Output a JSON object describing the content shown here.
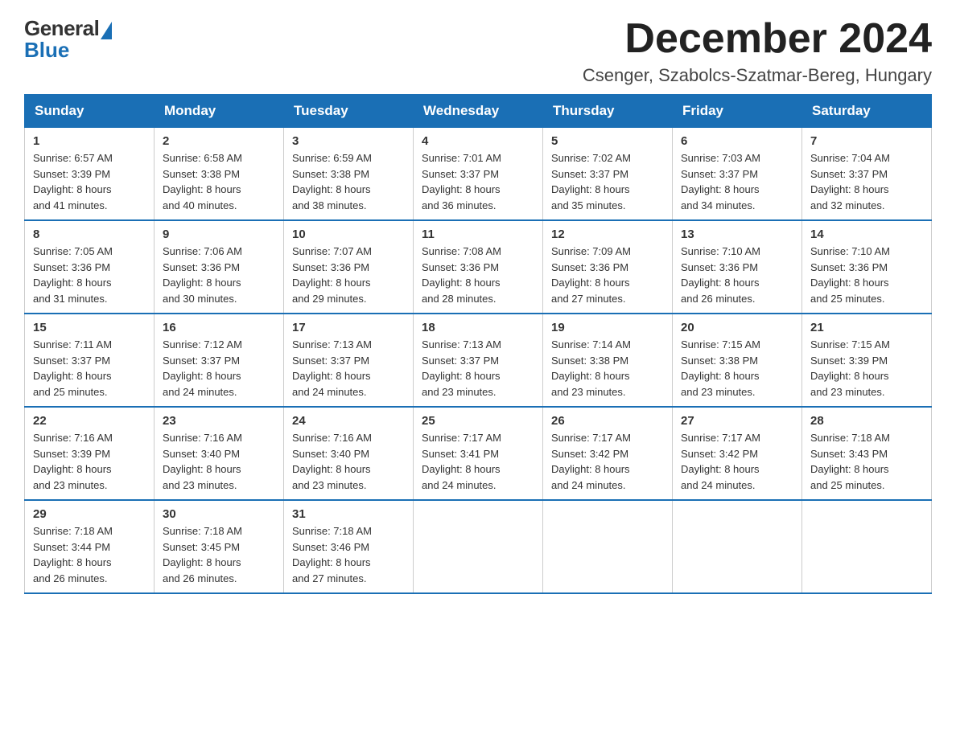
{
  "logo": {
    "general": "General",
    "blue": "Blue"
  },
  "title": "December 2024",
  "location": "Csenger, Szabolcs-Szatmar-Bereg, Hungary",
  "days_of_week": [
    "Sunday",
    "Monday",
    "Tuesday",
    "Wednesday",
    "Thursday",
    "Friday",
    "Saturday"
  ],
  "weeks": [
    [
      {
        "day": "1",
        "info": "Sunrise: 6:57 AM\nSunset: 3:39 PM\nDaylight: 8 hours\nand 41 minutes."
      },
      {
        "day": "2",
        "info": "Sunrise: 6:58 AM\nSunset: 3:38 PM\nDaylight: 8 hours\nand 40 minutes."
      },
      {
        "day": "3",
        "info": "Sunrise: 6:59 AM\nSunset: 3:38 PM\nDaylight: 8 hours\nand 38 minutes."
      },
      {
        "day": "4",
        "info": "Sunrise: 7:01 AM\nSunset: 3:37 PM\nDaylight: 8 hours\nand 36 minutes."
      },
      {
        "day": "5",
        "info": "Sunrise: 7:02 AM\nSunset: 3:37 PM\nDaylight: 8 hours\nand 35 minutes."
      },
      {
        "day": "6",
        "info": "Sunrise: 7:03 AM\nSunset: 3:37 PM\nDaylight: 8 hours\nand 34 minutes."
      },
      {
        "day": "7",
        "info": "Sunrise: 7:04 AM\nSunset: 3:37 PM\nDaylight: 8 hours\nand 32 minutes."
      }
    ],
    [
      {
        "day": "8",
        "info": "Sunrise: 7:05 AM\nSunset: 3:36 PM\nDaylight: 8 hours\nand 31 minutes."
      },
      {
        "day": "9",
        "info": "Sunrise: 7:06 AM\nSunset: 3:36 PM\nDaylight: 8 hours\nand 30 minutes."
      },
      {
        "day": "10",
        "info": "Sunrise: 7:07 AM\nSunset: 3:36 PM\nDaylight: 8 hours\nand 29 minutes."
      },
      {
        "day": "11",
        "info": "Sunrise: 7:08 AM\nSunset: 3:36 PM\nDaylight: 8 hours\nand 28 minutes."
      },
      {
        "day": "12",
        "info": "Sunrise: 7:09 AM\nSunset: 3:36 PM\nDaylight: 8 hours\nand 27 minutes."
      },
      {
        "day": "13",
        "info": "Sunrise: 7:10 AM\nSunset: 3:36 PM\nDaylight: 8 hours\nand 26 minutes."
      },
      {
        "day": "14",
        "info": "Sunrise: 7:10 AM\nSunset: 3:36 PM\nDaylight: 8 hours\nand 25 minutes."
      }
    ],
    [
      {
        "day": "15",
        "info": "Sunrise: 7:11 AM\nSunset: 3:37 PM\nDaylight: 8 hours\nand 25 minutes."
      },
      {
        "day": "16",
        "info": "Sunrise: 7:12 AM\nSunset: 3:37 PM\nDaylight: 8 hours\nand 24 minutes."
      },
      {
        "day": "17",
        "info": "Sunrise: 7:13 AM\nSunset: 3:37 PM\nDaylight: 8 hours\nand 24 minutes."
      },
      {
        "day": "18",
        "info": "Sunrise: 7:13 AM\nSunset: 3:37 PM\nDaylight: 8 hours\nand 23 minutes."
      },
      {
        "day": "19",
        "info": "Sunrise: 7:14 AM\nSunset: 3:38 PM\nDaylight: 8 hours\nand 23 minutes."
      },
      {
        "day": "20",
        "info": "Sunrise: 7:15 AM\nSunset: 3:38 PM\nDaylight: 8 hours\nand 23 minutes."
      },
      {
        "day": "21",
        "info": "Sunrise: 7:15 AM\nSunset: 3:39 PM\nDaylight: 8 hours\nand 23 minutes."
      }
    ],
    [
      {
        "day": "22",
        "info": "Sunrise: 7:16 AM\nSunset: 3:39 PM\nDaylight: 8 hours\nand 23 minutes."
      },
      {
        "day": "23",
        "info": "Sunrise: 7:16 AM\nSunset: 3:40 PM\nDaylight: 8 hours\nand 23 minutes."
      },
      {
        "day": "24",
        "info": "Sunrise: 7:16 AM\nSunset: 3:40 PM\nDaylight: 8 hours\nand 23 minutes."
      },
      {
        "day": "25",
        "info": "Sunrise: 7:17 AM\nSunset: 3:41 PM\nDaylight: 8 hours\nand 24 minutes."
      },
      {
        "day": "26",
        "info": "Sunrise: 7:17 AM\nSunset: 3:42 PM\nDaylight: 8 hours\nand 24 minutes."
      },
      {
        "day": "27",
        "info": "Sunrise: 7:17 AM\nSunset: 3:42 PM\nDaylight: 8 hours\nand 24 minutes."
      },
      {
        "day": "28",
        "info": "Sunrise: 7:18 AM\nSunset: 3:43 PM\nDaylight: 8 hours\nand 25 minutes."
      }
    ],
    [
      {
        "day": "29",
        "info": "Sunrise: 7:18 AM\nSunset: 3:44 PM\nDaylight: 8 hours\nand 26 minutes."
      },
      {
        "day": "30",
        "info": "Sunrise: 7:18 AM\nSunset: 3:45 PM\nDaylight: 8 hours\nand 26 minutes."
      },
      {
        "day": "31",
        "info": "Sunrise: 7:18 AM\nSunset: 3:46 PM\nDaylight: 8 hours\nand 27 minutes."
      },
      {
        "day": "",
        "info": ""
      },
      {
        "day": "",
        "info": ""
      },
      {
        "day": "",
        "info": ""
      },
      {
        "day": "",
        "info": ""
      }
    ]
  ]
}
